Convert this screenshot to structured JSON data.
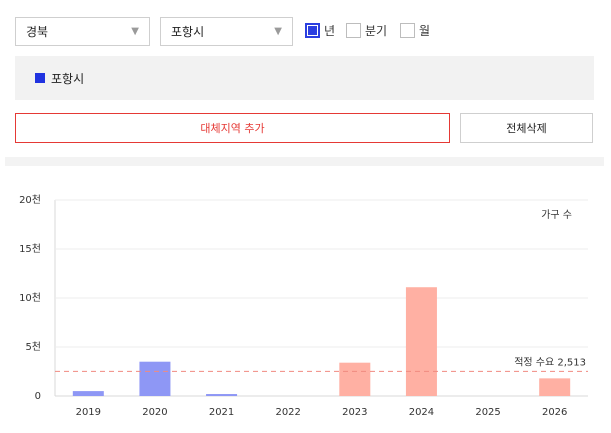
{
  "filters": {
    "region": "경북",
    "city": "포항시",
    "periods": [
      {
        "label": "년",
        "checked": true
      },
      {
        "label": "분기",
        "checked": false
      },
      {
        "label": "월",
        "checked": false
      }
    ]
  },
  "selected_area": {
    "label": "포항시",
    "color": "#2033e0"
  },
  "actions": {
    "add_label": "대체지역 추가",
    "clear_label": "전체삭제"
  },
  "chart_data": {
    "type": "bar",
    "categories": [
      "2019",
      "2020",
      "2021",
      "2022",
      "2023",
      "2024",
      "2025",
      "2026"
    ],
    "series": [
      {
        "name": "가구 수",
        "values": [
          500,
          3500,
          200,
          0,
          3400,
          11100,
          0,
          1800
        ]
      }
    ],
    "bar_colors": [
      "#8e97f5",
      "#8e97f5",
      "#8e97f5",
      "#8e97f5",
      "#ffb0a3",
      "#ffb0a3",
      "#ffb0a3",
      "#ffb0a3"
    ],
    "ylim": [
      0,
      20000
    ],
    "yticks": [
      {
        "value": 0,
        "label": "0"
      },
      {
        "value": 5000,
        "label": "5천"
      },
      {
        "value": 10000,
        "label": "10천"
      },
      {
        "value": 15000,
        "label": "15천"
      },
      {
        "value": 20000,
        "label": "20천"
      }
    ],
    "series_label": "가구 수",
    "reference_line": {
      "value": 2513,
      "label": "적정 수요 2,513",
      "color": "#f08a80"
    },
    "grid": true
  }
}
